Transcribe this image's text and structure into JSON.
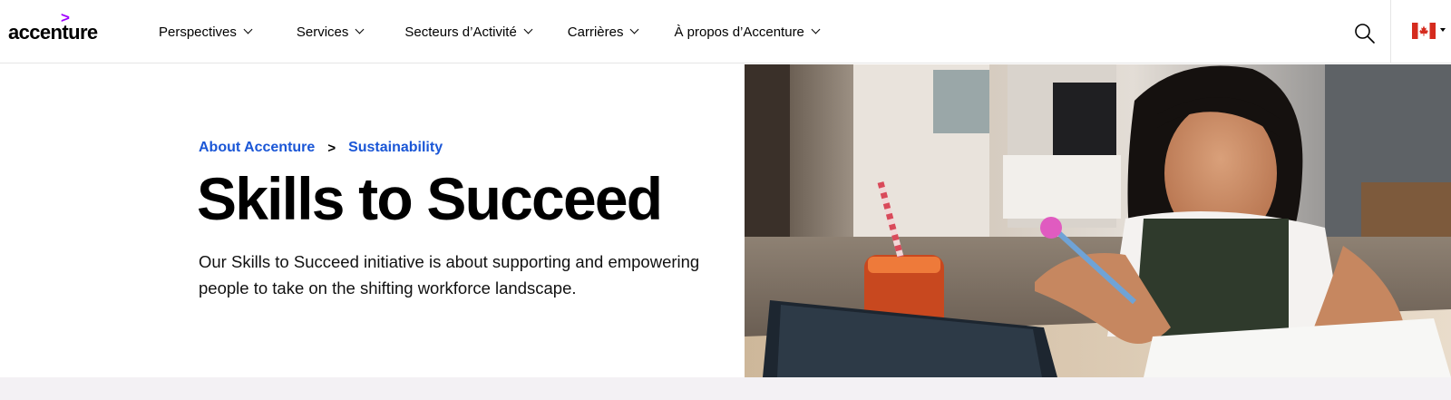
{
  "brand": {
    "logo_text": "accenture",
    "logo_mark": ">",
    "accent_color": "#a100ff"
  },
  "nav": {
    "items": [
      {
        "label": "Perspectives"
      },
      {
        "label": "Services"
      },
      {
        "label": "Secteurs d’Activité"
      },
      {
        "label": "Carrières"
      },
      {
        "label": "À propos d’Accenture"
      }
    ],
    "search_icon": "search-icon",
    "locale_icon": "canada-flag-icon"
  },
  "hero": {
    "breadcrumb": [
      {
        "label": "About Accenture"
      },
      {
        "label": "Sustainability"
      }
    ],
    "breadcrumb_separator": ">",
    "title": "Skills to Succeed",
    "description": "Our Skills to Succeed initiative is about supporting and empowering people to take on the shifting workforce landscape.",
    "image": "photo-girl-studying-icon",
    "link_color": "#1a56d6"
  }
}
